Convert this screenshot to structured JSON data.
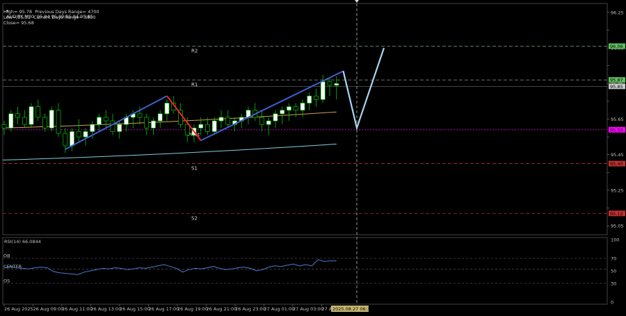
{
  "header": {
    "symbol_line": "AUDJPY,M30  95.84 95.89 95.84 95.85",
    "high_label": "High= 95.78",
    "prev_range_label": "Previous Days Range= 4700",
    "low_label": "Low= 95.31",
    "curr_range_label": "Current Days Range= 3800",
    "close_label": "Close= 95.68"
  },
  "colors": {
    "background": "#000000",
    "bull_candle": "#ffffff",
    "bear_candle": "#000000",
    "candle_edge": "#00c800",
    "pivot_level": "#ff00ff",
    "resistance": "#80a080",
    "support": "#b03030",
    "ma_fast": "#d2a050",
    "ma_slow": "#80d0e0",
    "zigzag_up": "#4060d0",
    "zigzag_down": "#ff2020",
    "projection": "#a8d8f0",
    "rsi_line": "#4a7bd0",
    "grid": "#3a3a3a"
  },
  "chart_data": [
    {
      "type": "candlestick",
      "price_axis_ticks": [
        "96.25",
        "96.05",
        "95.85",
        "95.65",
        "95.45",
        "95.25",
        "95.05"
      ],
      "tick_values": [
        96.25,
        96.15,
        96.05,
        95.95,
        95.85,
        95.75,
        95.65,
        95.55,
        95.45,
        95.35,
        95.25,
        95.15,
        95.05
      ],
      "ylim": [
        95.0,
        96.3
      ],
      "levels": [
        {
          "name": "R2",
          "value": 96.06,
          "label": "96.06",
          "color": "#60c060"
        },
        {
          "name": "R1",
          "value": 95.87,
          "label": "95.87",
          "color": "#60c060"
        },
        {
          "name": "Pivot",
          "value": 95.59,
          "label": "95.59",
          "color": "#ff00ff"
        },
        {
          "name": "S1",
          "value": 95.4,
          "label": "95.40",
          "color": "#c03030"
        },
        {
          "name": "S2",
          "value": 95.12,
          "label": "95.12",
          "color": "#c03030"
        }
      ],
      "current_price": {
        "value": 95.85,
        "label": "95.85"
      },
      "candles": [
        [
          95.62,
          95.64,
          95.56,
          95.6
        ],
        [
          95.6,
          95.7,
          95.58,
          95.68
        ],
        [
          95.68,
          95.72,
          95.62,
          95.66
        ],
        [
          95.66,
          95.7,
          95.6,
          95.62
        ],
        [
          95.62,
          95.74,
          95.6,
          95.72
        ],
        [
          95.72,
          95.76,
          95.64,
          95.66
        ],
        [
          95.66,
          95.68,
          95.58,
          95.6
        ],
        [
          95.6,
          95.72,
          95.58,
          95.7
        ],
        [
          95.7,
          95.74,
          95.55,
          95.57
        ],
        [
          95.57,
          95.6,
          95.46,
          95.5
        ],
        [
          95.5,
          95.6,
          95.47,
          95.58
        ],
        [
          95.58,
          95.65,
          95.52,
          95.55
        ],
        [
          95.55,
          95.6,
          95.5,
          95.58
        ],
        [
          95.58,
          95.64,
          95.54,
          95.62
        ],
        [
          95.62,
          95.68,
          95.58,
          95.66
        ],
        [
          95.66,
          95.7,
          95.6,
          95.64
        ],
        [
          95.64,
          95.68,
          95.56,
          95.58
        ],
        [
          95.58,
          95.64,
          95.54,
          95.62
        ],
        [
          95.62,
          95.68,
          95.58,
          95.66
        ],
        [
          95.66,
          95.7,
          95.6,
          95.68
        ],
        [
          95.68,
          95.72,
          95.62,
          95.66
        ],
        [
          95.66,
          95.68,
          95.56,
          95.6
        ],
        [
          95.6,
          95.66,
          95.56,
          95.64
        ],
        [
          95.64,
          95.7,
          95.6,
          95.68
        ],
        [
          95.68,
          95.76,
          95.64,
          95.74
        ],
        [
          95.74,
          95.78,
          95.68,
          95.7
        ],
        [
          95.7,
          95.74,
          95.6,
          95.62
        ],
        [
          95.62,
          95.66,
          95.52,
          95.56
        ],
        [
          95.56,
          95.62,
          95.52,
          95.6
        ],
        [
          95.6,
          95.66,
          95.56,
          95.62
        ],
        [
          95.62,
          95.66,
          95.56,
          95.58
        ],
        [
          95.58,
          95.66,
          95.56,
          95.64
        ],
        [
          95.64,
          95.7,
          95.6,
          95.66
        ],
        [
          95.66,
          95.7,
          95.6,
          95.62
        ],
        [
          95.62,
          95.66,
          95.58,
          95.64
        ],
        [
          95.64,
          95.68,
          95.6,
          95.66
        ],
        [
          95.66,
          95.72,
          95.62,
          95.7
        ],
        [
          95.7,
          95.74,
          95.64,
          95.66
        ],
        [
          95.66,
          95.7,
          95.58,
          95.62
        ],
        [
          95.62,
          95.66,
          95.56,
          95.64
        ],
        [
          95.64,
          95.7,
          95.6,
          95.68
        ],
        [
          95.68,
          95.72,
          95.62,
          95.7
        ],
        [
          95.7,
          95.74,
          95.64,
          95.72
        ],
        [
          95.72,
          95.74,
          95.66,
          95.7
        ],
        [
          95.7,
          95.76,
          95.66,
          95.74
        ],
        [
          95.74,
          95.8,
          95.7,
          95.78
        ],
        [
          95.78,
          95.82,
          95.72,
          95.76
        ],
        [
          95.76,
          95.9,
          95.74,
          95.86
        ],
        [
          95.86,
          95.88,
          95.78,
          95.84
        ],
        [
          95.84,
          95.89,
          95.76,
          95.85
        ]
      ],
      "moving_averages": [
        {
          "name": "ma_fast",
          "start": 95.6,
          "end": 95.69
        },
        {
          "name": "ma_slow",
          "start": 95.42,
          "end": 95.51
        }
      ],
      "zigzag": [
        [
          9,
          95.48
        ],
        [
          24,
          95.78
        ],
        [
          29,
          95.53
        ],
        [
          50,
          95.92
        ]
      ],
      "projection": [
        [
          50,
          95.92
        ],
        [
          52,
          95.6
        ],
        [
          56,
          96.05
        ]
      ],
      "x_tick_labels": [
        "26 Aug 2025",
        "26 Aug 09:00",
        "26 Aug 11:00",
        "26 Aug 13:00",
        "26 Aug 15:00",
        "26 Aug 17:00",
        "26 Aug 19:00",
        "26 Aug 21:00",
        "26 Aug 23:00",
        "27 Aug 01:00",
        "27 Aug 03:00",
        "27 Aug 05:00"
      ],
      "cursor_time_label": "2025.08.27 06:30"
    },
    {
      "type": "line",
      "title": "RSI(14) 66.0844",
      "ylim": [
        0,
        100
      ],
      "y_ticks": [
        "100",
        "70",
        "50",
        "30",
        "0"
      ],
      "levels": [
        {
          "name": "OB",
          "value": 70
        },
        {
          "name": "CENTER",
          "value": 53
        },
        {
          "name": "OS",
          "value": 30
        }
      ],
      "values": [
        55,
        57,
        55,
        54,
        53,
        55,
        56,
        55,
        49,
        47,
        46,
        45,
        44,
        48,
        50,
        52,
        54,
        53,
        55,
        54,
        52,
        53,
        55,
        54,
        56,
        58,
        60,
        57,
        54,
        48,
        52,
        54,
        53,
        55,
        57,
        54,
        52,
        53,
        55,
        56,
        54,
        50,
        52,
        56,
        58,
        57,
        59,
        61,
        58,
        60,
        58,
        68,
        65,
        66,
        66
      ]
    }
  ]
}
